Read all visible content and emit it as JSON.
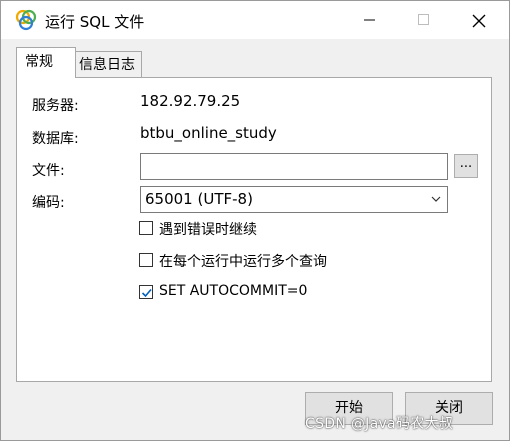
{
  "window": {
    "title": "运行 SQL 文件",
    "icon": "navicat-app-icon"
  },
  "tabs": [
    {
      "label": "常规",
      "active": true
    },
    {
      "label": "信息日志",
      "active": false
    }
  ],
  "general": {
    "server_label": "服务器:",
    "server_value": "182.92.79.25",
    "database_label": "数据库:",
    "database_value": "btbu_online_study",
    "file_label": "文件:",
    "file_value": "",
    "browse_label": "...",
    "encoding_label": "编码:",
    "encoding_value": "65001 (UTF-8)"
  },
  "options": [
    {
      "label": "遇到错误时继续",
      "checked": false
    },
    {
      "label": "在每个运行中运行多个查询",
      "checked": false
    },
    {
      "label": "SET AUTOCOMMIT=0",
      "checked": true
    }
  ],
  "buttons": {
    "start": "开始",
    "close": "关闭"
  },
  "watermark": "CSDN @Java码农大叔",
  "colors": {
    "check_accent": "#0060c0",
    "panel_bg": "#ffffff",
    "dialog_bg": "#f0f0f0"
  }
}
